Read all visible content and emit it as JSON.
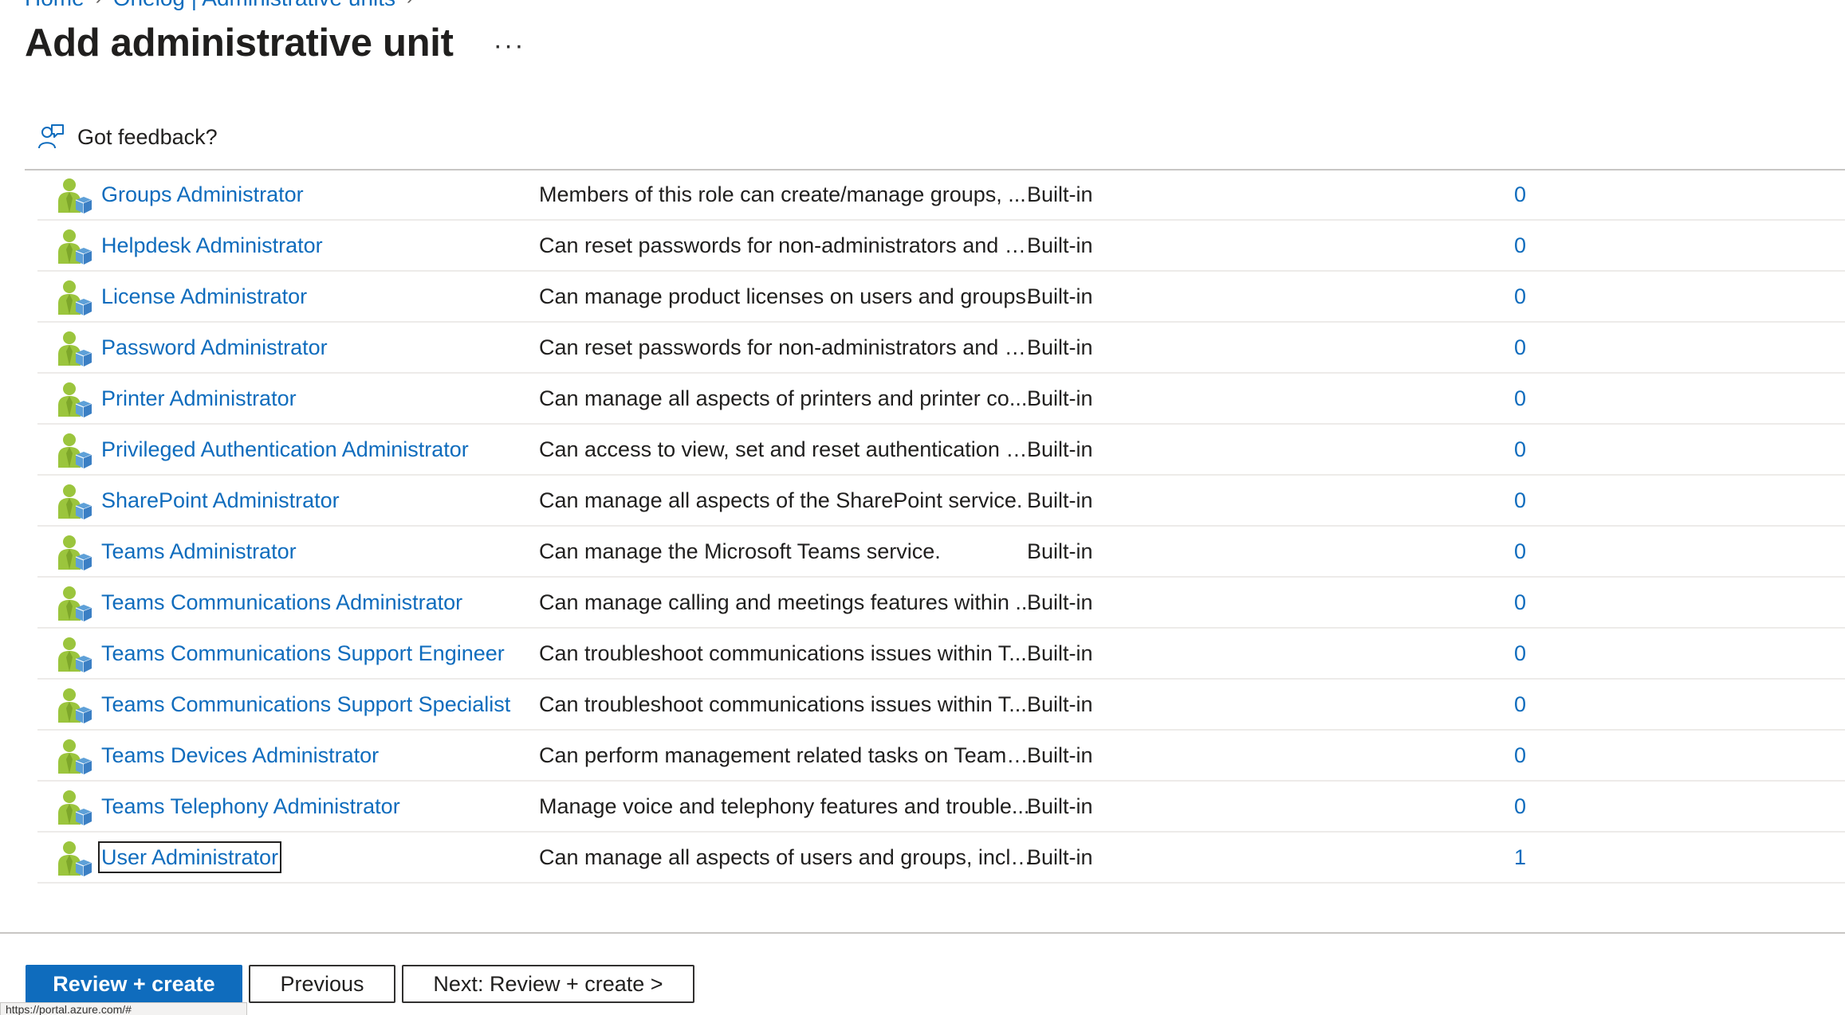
{
  "breadcrumb": [
    {
      "label": "Home"
    },
    {
      "label": "Onelog | Administrative units"
    }
  ],
  "page": {
    "title": "Add administrative unit",
    "more_label": "···"
  },
  "feedback": {
    "label": "Got feedback?"
  },
  "roles": [
    {
      "name": "Groups Administrator",
      "description": "Members of this role can create/manage groups, ...",
      "type": "Built-in",
      "count": "0"
    },
    {
      "name": "Helpdesk Administrator",
      "description": "Can reset passwords for non-administrators and H...",
      "type": "Built-in",
      "count": "0"
    },
    {
      "name": "License Administrator",
      "description": "Can manage product licenses on users and groups.",
      "type": "Built-in",
      "count": "0"
    },
    {
      "name": "Password Administrator",
      "description": "Can reset passwords for non-administrators and P...",
      "type": "Built-in",
      "count": "0"
    },
    {
      "name": "Printer Administrator",
      "description": "Can manage all aspects of printers and printer co...",
      "type": "Built-in",
      "count": "0"
    },
    {
      "name": "Privileged Authentication Administrator",
      "description": "Can access to view, set and reset authentication m...",
      "type": "Built-in",
      "count": "0"
    },
    {
      "name": "SharePoint Administrator",
      "description": "Can manage all aspects of the SharePoint service.",
      "type": "Built-in",
      "count": "0"
    },
    {
      "name": "Teams Administrator",
      "description": "Can manage the Microsoft Teams service.",
      "type": "Built-in",
      "count": "0"
    },
    {
      "name": "Teams Communications Administrator",
      "description": "Can manage calling and meetings features within ...",
      "type": "Built-in",
      "count": "0"
    },
    {
      "name": "Teams Communications Support Engineer",
      "description": "Can troubleshoot communications issues within T...",
      "type": "Built-in",
      "count": "0"
    },
    {
      "name": "Teams Communications Support Specialist",
      "description": "Can troubleshoot communications issues within T...",
      "type": "Built-in",
      "count": "0"
    },
    {
      "name": "Teams Devices Administrator",
      "description": "Can perform management related tasks on Teams...",
      "type": "Built-in",
      "count": "0"
    },
    {
      "name": "Teams Telephony Administrator",
      "description": "Manage voice and telephony features and trouble...",
      "type": "Built-in",
      "count": "0"
    },
    {
      "name": "User Administrator",
      "description": "Can manage all aspects of users and groups, inclu...",
      "type": "Built-in",
      "count": "1",
      "focused": true
    }
  ],
  "footer": {
    "review_create_label": "Review + create",
    "previous_label": "Previous",
    "next_label": "Next: Review + create >"
  },
  "status_bar": {
    "url": "https://portal.azure.com/#"
  },
  "icons": {
    "role": "role-user-icon",
    "feedback": "feedback-person-icon"
  },
  "colors": {
    "link": "#0f6cbd",
    "primary_button": "#0f6cbd"
  }
}
